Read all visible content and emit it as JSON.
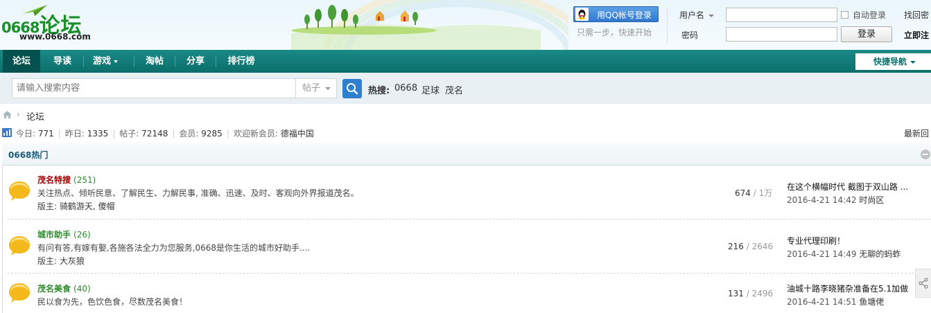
{
  "brand": {
    "logo_number": "0668",
    "logo_text": "论坛",
    "logo_url": "www.0668.com"
  },
  "login": {
    "qq_button": "用QQ帐号登录",
    "qq_hint": "只需一步，快速开始",
    "username_label": "用户名",
    "password_label": "密码",
    "auto_login": "自动登录",
    "login_button": "登录",
    "find_password": "找回密",
    "register": "立即注"
  },
  "nav": {
    "items": [
      {
        "label": "论坛",
        "active": true
      },
      {
        "label": "导读"
      },
      {
        "label": "游戏"
      },
      {
        "label": "淘帖"
      },
      {
        "label": "分享"
      },
      {
        "label": "排行榜"
      }
    ],
    "quick_nav": "快捷导航"
  },
  "search": {
    "placeholder": "请输入搜索内容",
    "type": "帖子",
    "hot_label": "热搜:",
    "hot_keywords": [
      "0668",
      "足球",
      "茂名"
    ]
  },
  "breadcrumb": {
    "current": "论坛"
  },
  "stats": {
    "today_label": "今日:",
    "today": "771",
    "yesterday_label": "昨日:",
    "yesterday": "1335",
    "posts_label": "帖子:",
    "posts": "72148",
    "members_label": "会员:",
    "members": "9285",
    "new_member_label": "欢迎新会员:",
    "new_member": "德福中国",
    "latest": "最新回"
  },
  "category": {
    "title": "0668热门",
    "forums": [
      {
        "name": "茂名特搜",
        "count": "(251)",
        "desc": "关注热点、倾听民意、了解民生、力解民事, 准确、迅速、及时、客观向外界报道茂名。",
        "mod_label": "版主:",
        "mods": "骑鹤游天, 傻帽",
        "threads": "674",
        "posts": "1万",
        "last_title": "在这个横幅时代 截图于双山路 ...",
        "last_time": "2016-4-21 14:42",
        "last_user": "时尚区"
      },
      {
        "name": "城市助手",
        "count": "(26)",
        "desc": "有问有答,有嫁有娶,各施各法全力为您服务,0668是你生活的城市好助手....",
        "mod_label": "版主:",
        "mods": "大灰狼",
        "threads": "216",
        "posts": "2646",
        "last_title": "专业代理印刷！",
        "last_time": "2016-4-21 14:49",
        "last_user": "无聊的蚂蚱"
      },
      {
        "name": "茂名美食",
        "count": "(40)",
        "desc": "民以食为先，色饮色食，尽数茂名美食！",
        "mod_label": "",
        "mods": "",
        "threads": "131",
        "posts": "2496",
        "last_title": "油城十路李晓猪杂准备在5.1加做",
        "last_time": "2016-4-21 14:51",
        "last_user": "鱼塘佬"
      }
    ]
  },
  "colors": {
    "nav_bg": "#0b6e6a",
    "nav_active": "#05514f",
    "forum_name_red": "#a40000",
    "forum_name_green": "#2f8a2f",
    "search_btn": "#2e7fcd"
  }
}
